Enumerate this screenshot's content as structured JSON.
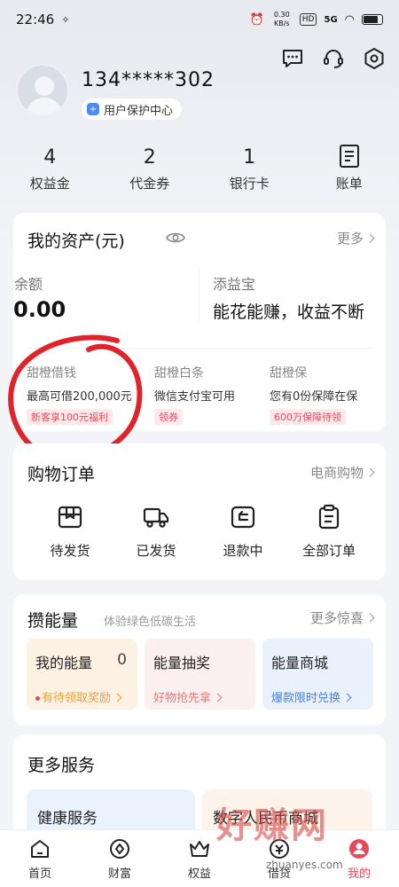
{
  "status_bar": {
    "time": "22:46",
    "net_speed": "0.30 KB/s",
    "hd": "HD",
    "signal": "5G"
  },
  "user": {
    "phone": "134*****302",
    "protection_label": "用户保护中心"
  },
  "header_icons": [
    "message-icon",
    "customer-service-icon",
    "settings-icon"
  ],
  "stats": [
    {
      "value": "4",
      "label": "权益金"
    },
    {
      "value": "2",
      "label": "代金券"
    },
    {
      "value": "1",
      "label": "银行卡"
    },
    {
      "value": "",
      "label": "账单"
    }
  ],
  "assets": {
    "title": "我的资产(元)",
    "more": "更多",
    "balance_label": "余额",
    "balance": "0.00",
    "tianyibao_label": "添益宝",
    "tianyibao_desc": "能花能赚，收益不断",
    "products": [
      {
        "name": "甜橙借钱",
        "desc": "最高可借200,000元",
        "tag": "新客享100元福利"
      },
      {
        "name": "甜橙白条",
        "desc": "微信支付宝可用",
        "tag": "领券"
      },
      {
        "name": "甜橙保",
        "desc": "您有0份保障在保",
        "tag": "600万保障待领"
      }
    ]
  },
  "orders": {
    "title": "购物订单",
    "more": "电商购物",
    "items": [
      {
        "label": "待发货",
        "icon": "package-icon"
      },
      {
        "label": "已发货",
        "icon": "truck-icon"
      },
      {
        "label": "退款中",
        "icon": "refund-icon"
      },
      {
        "label": "全部订单",
        "icon": "order-list-icon"
      }
    ]
  },
  "energy": {
    "title": "攒能量",
    "subtitle": "体验绿色低碳生活",
    "more": "更多惊喜",
    "tiles": [
      {
        "title": "我的能量",
        "value": "0",
        "sub": "有待领取奖励",
        "sub_color": "#e6a23c"
      },
      {
        "title": "能量抽奖",
        "value": "",
        "sub": "好物抢先拿",
        "sub_color": "#e07a7a"
      },
      {
        "title": "能量商城",
        "value": "",
        "sub": "爆款限时兑换",
        "sub_color": "#4a7fd6"
      }
    ]
  },
  "services": {
    "title": "更多服务",
    "items": [
      {
        "label": "健康服务"
      },
      {
        "label": "数字人民币商城"
      }
    ]
  },
  "tabbar": [
    {
      "label": "首页",
      "active": false
    },
    {
      "label": "财富",
      "active": false
    },
    {
      "label": "权益",
      "active": false
    },
    {
      "label": "借贷",
      "active": false
    },
    {
      "label": "我的",
      "active": true
    }
  ],
  "watermark": {
    "text": "好赚网",
    "url": "zhuanyes.com"
  }
}
